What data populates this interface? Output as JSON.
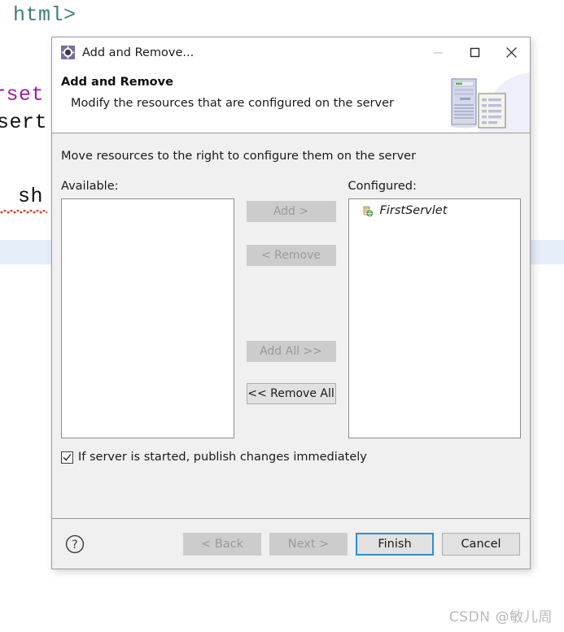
{
  "background_editor": {
    "lines": [
      {
        "text": "html>",
        "kind": "tag"
      },
      {
        "text": "rset",
        "kind": "attr"
      },
      {
        "text": "sert",
        "kind": "text"
      },
      {
        "text": "sh",
        "kind": "text"
      }
    ]
  },
  "watermark": {
    "text": "CSDN @敏儿周"
  },
  "dialog": {
    "titlebar": {
      "icon": "add-remove-icon",
      "title": "Add and Remove...",
      "minimize_label": "minimize-icon",
      "maximize_label": "maximize-icon",
      "close_label": "close-icon"
    },
    "header": {
      "title": "Add and Remove",
      "subtitle": "Modify the resources that are configured on the server",
      "banner_icon": "server-and-document-icon"
    },
    "body": {
      "intro": "Move resources to the right to configure them on the server",
      "available": {
        "label": "Available:",
        "items": []
      },
      "configured": {
        "label": "Configured:",
        "items": [
          {
            "name": "FirstServlet",
            "icon": "web-module-icon"
          }
        ]
      },
      "transfer_buttons": [
        {
          "label": "Add >",
          "enabled": false
        },
        {
          "label": "< Remove",
          "enabled": false
        },
        {
          "label": "Add All >>",
          "enabled": false
        },
        {
          "label": "<< Remove All",
          "enabled": true
        }
      ],
      "publish_checkbox": {
        "label": "If server is started, publish changes immediately",
        "checked": true
      }
    },
    "footer": {
      "help_label": "help-icon",
      "buttons": [
        {
          "label": "< Back",
          "enabled": false
        },
        {
          "label": "Next >",
          "enabled": false
        },
        {
          "label": "Finish",
          "enabled": true,
          "default": true
        },
        {
          "label": "Cancel",
          "enabled": true
        }
      ]
    }
  },
  "colors": {
    "dialog_bg": "#f0f0f0",
    "accent_focus": "#2a8fd8",
    "disabled_text": "#9a9a9a",
    "editor_tag": "#3f7f7f",
    "editor_attr": "#a020a0",
    "highlight_line": "#e6eefa"
  }
}
